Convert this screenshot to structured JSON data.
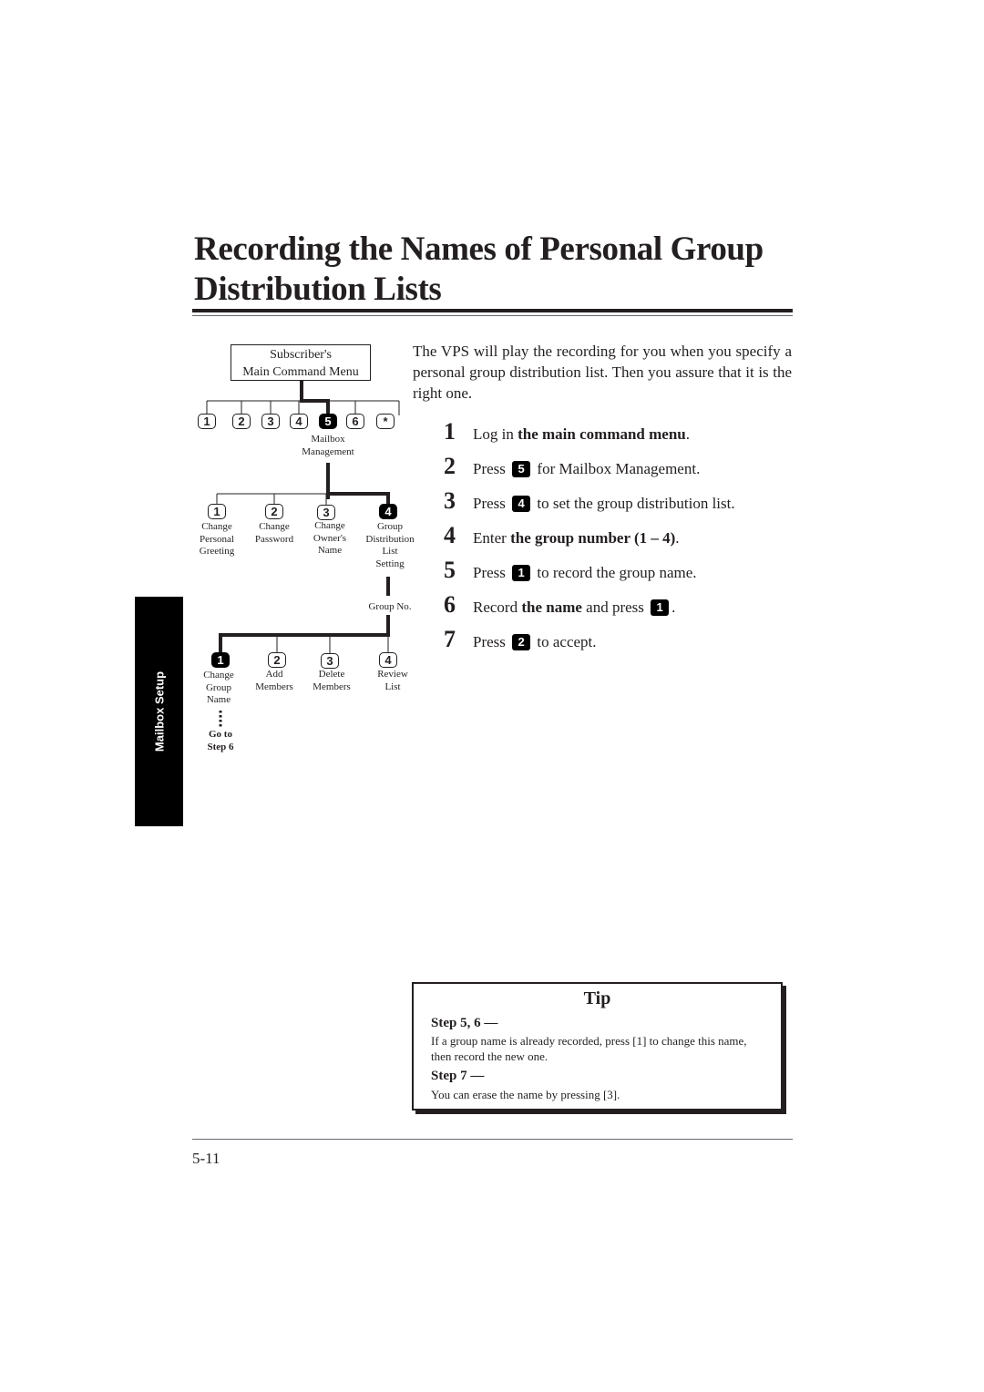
{
  "page": {
    "title_line1": "Recording the Names of Personal Group",
    "title_line2": "Distribution Lists",
    "side_tab": "Mailbox Setup",
    "page_number": "5-11"
  },
  "diagram": {
    "root_line1": "Subscriber's",
    "root_line2": "Main Command Menu",
    "level1_keys": [
      {
        "label": "1",
        "active": false
      },
      {
        "label": "2",
        "active": false
      },
      {
        "label": "3",
        "active": false
      },
      {
        "label": "4",
        "active": false
      },
      {
        "label": "5",
        "active": true
      },
      {
        "label": "6",
        "active": false
      },
      {
        "label": "*",
        "active": false
      }
    ],
    "level1_caption_line1": "Mailbox",
    "level1_caption_line2": "Management",
    "level2_keys": [
      {
        "label": "1",
        "active": false,
        "caption": [
          "Change",
          "Personal",
          "Greeting"
        ]
      },
      {
        "label": "2",
        "active": false,
        "caption": [
          "Change",
          "Password"
        ]
      },
      {
        "label": "3",
        "active": false,
        "caption": [
          "Change",
          "Owner's",
          "Name"
        ]
      },
      {
        "label": "4",
        "active": true,
        "caption": [
          "Group",
          "Distribution",
          "List",
          "Setting"
        ]
      }
    ],
    "group_no_label": "Group No.",
    "level3_keys": [
      {
        "label": "1",
        "active": true,
        "caption": [
          "Change",
          "Group",
          "Name"
        ]
      },
      {
        "label": "2",
        "active": false,
        "caption": [
          "Add",
          "Members"
        ]
      },
      {
        "label": "3",
        "active": false,
        "caption": [
          "Delete",
          "Members"
        ]
      },
      {
        "label": "4",
        "active": false,
        "caption": [
          "Review",
          "List"
        ]
      }
    ],
    "goto_line1": "Go to",
    "goto_line2": "Step 6"
  },
  "intro": "The VPS will play the recording for you when you specify a personal group distribution list. Then you assure that it is the right one.",
  "steps": [
    {
      "num": "1",
      "pre": "Log in ",
      "bold": "the main command menu",
      "post": "."
    },
    {
      "num": "2",
      "pre": "Press ",
      "key": "5",
      "post": " for Mailbox Management."
    },
    {
      "num": "3",
      "pre": "Press ",
      "key": "4",
      "post": " to set the group distribution list."
    },
    {
      "num": "4",
      "pre": "Enter ",
      "bold": "the group number (1 – 4)",
      "post": "."
    },
    {
      "num": "5",
      "pre": "Press ",
      "key": "1",
      "post": " to record the group name."
    },
    {
      "num": "6",
      "pre": "Record ",
      "bold": "the name",
      "mid": " and press ",
      "key": "1",
      "post": "."
    },
    {
      "num": "7",
      "pre": "Press ",
      "key": "2",
      "post": " to accept."
    }
  ],
  "tip": {
    "title": "Tip",
    "sections": [
      {
        "heading": "Step 5, 6 —",
        "body": "If a group name is already recorded, press [1] to change this name, then record the new one."
      },
      {
        "heading": "Step 7 —",
        "body": "You can erase the name by pressing [3]."
      }
    ]
  }
}
